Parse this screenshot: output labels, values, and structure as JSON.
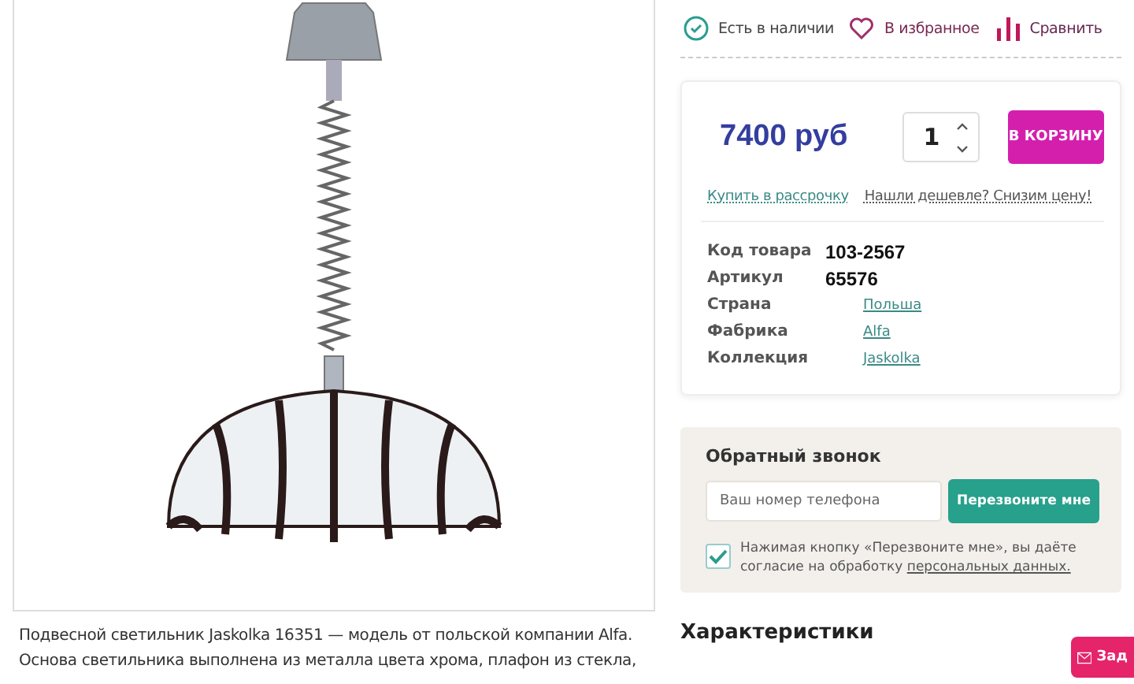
{
  "status_bar": [
    {
      "kind": "stock",
      "label": "Есть в наличии"
    },
    {
      "kind": "favorite",
      "label": "В избранное"
    },
    {
      "kind": "compare",
      "label": "Сравнить"
    }
  ],
  "purchase": {
    "price": "7400 руб",
    "quantity": "1",
    "cart_button": "В КОРЗИНУ",
    "links": [
      "Купить в рассрочку",
      "Нашли дешевле? Снизим цену!"
    ]
  },
  "specs": [
    {
      "kind": "text",
      "label": "Код товара",
      "value": "103-2567"
    },
    {
      "kind": "text",
      "label": "Артикул",
      "value": "65576"
    },
    {
      "kind": "link",
      "label": "Страна",
      "value": "Польша"
    },
    {
      "kind": "link",
      "label": "Фабрика",
      "value": "Alfa"
    },
    {
      "kind": "link",
      "label": "Коллекция",
      "value": "Jaskolka"
    }
  ],
  "callback": {
    "title": "Обратный звонок",
    "placeholder": "Ваш номер телефона",
    "button": "Перезвоните мне",
    "consent": {
      "checked": true,
      "text": "Нажимая кнопку «Перезвоните мне», вы даёте согласие на обработку",
      "link": "персональных данных."
    }
  },
  "description": "Подвесной светильник Jaskolka 16351 — модель от польской компании Alfa. Основа светильника выполнена из металла цвета хрома, плафон из стекла,",
  "characteristics_heading": "Характеристики",
  "ask_button": "Зад"
}
